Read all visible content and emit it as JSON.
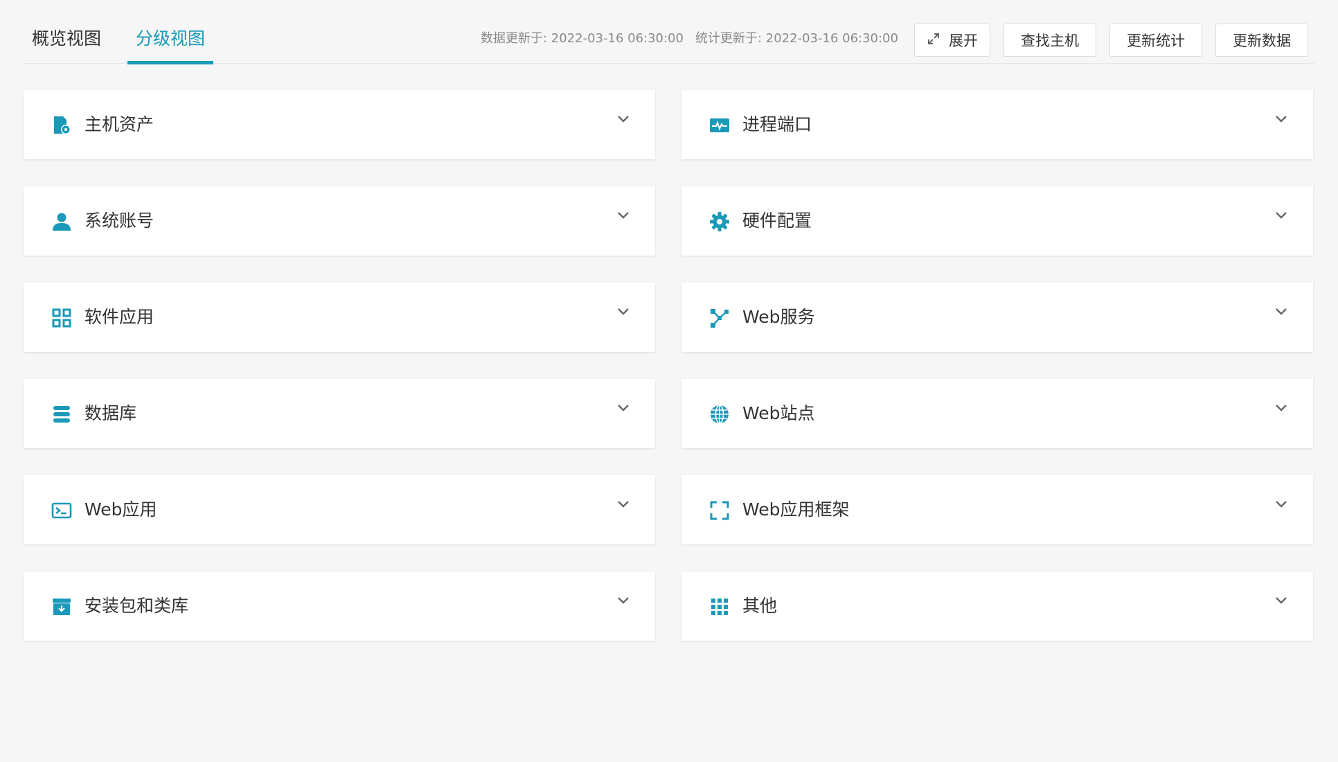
{
  "tabs": {
    "overview": "概览视图",
    "tiered": "分级视图"
  },
  "status": {
    "data_updated": "数据更新于: 2022-03-16 06:30:00",
    "stats_updated": "统计更新于: 2022-03-16 06:30:00"
  },
  "toolbar": {
    "expand": "展开",
    "find_host": "查找主机",
    "update_stats": "更新统计",
    "update_data": "更新数据"
  },
  "theme": {
    "accent": "#1a99b8",
    "icon": "#1a99b8"
  },
  "cards": [
    {
      "label": "主机资产",
      "icon": "host-settings-icon"
    },
    {
      "label": "进程端口",
      "icon": "monitor-pulse-icon"
    },
    {
      "label": "系统账号",
      "icon": "user-icon"
    },
    {
      "label": "硬件配置",
      "icon": "gear-icon"
    },
    {
      "label": "软件应用",
      "icon": "apps-grid-icon"
    },
    {
      "label": "Web服务",
      "icon": "network-nodes-icon"
    },
    {
      "label": "数据库",
      "icon": "database-icon"
    },
    {
      "label": "Web站点",
      "icon": "globe-icon"
    },
    {
      "label": "Web应用",
      "icon": "terminal-window-icon"
    },
    {
      "label": "Web应用框架",
      "icon": "frame-corners-icon"
    },
    {
      "label": "安装包和类库",
      "icon": "archive-box-icon"
    },
    {
      "label": "其他",
      "icon": "dots-grid-icon"
    }
  ]
}
